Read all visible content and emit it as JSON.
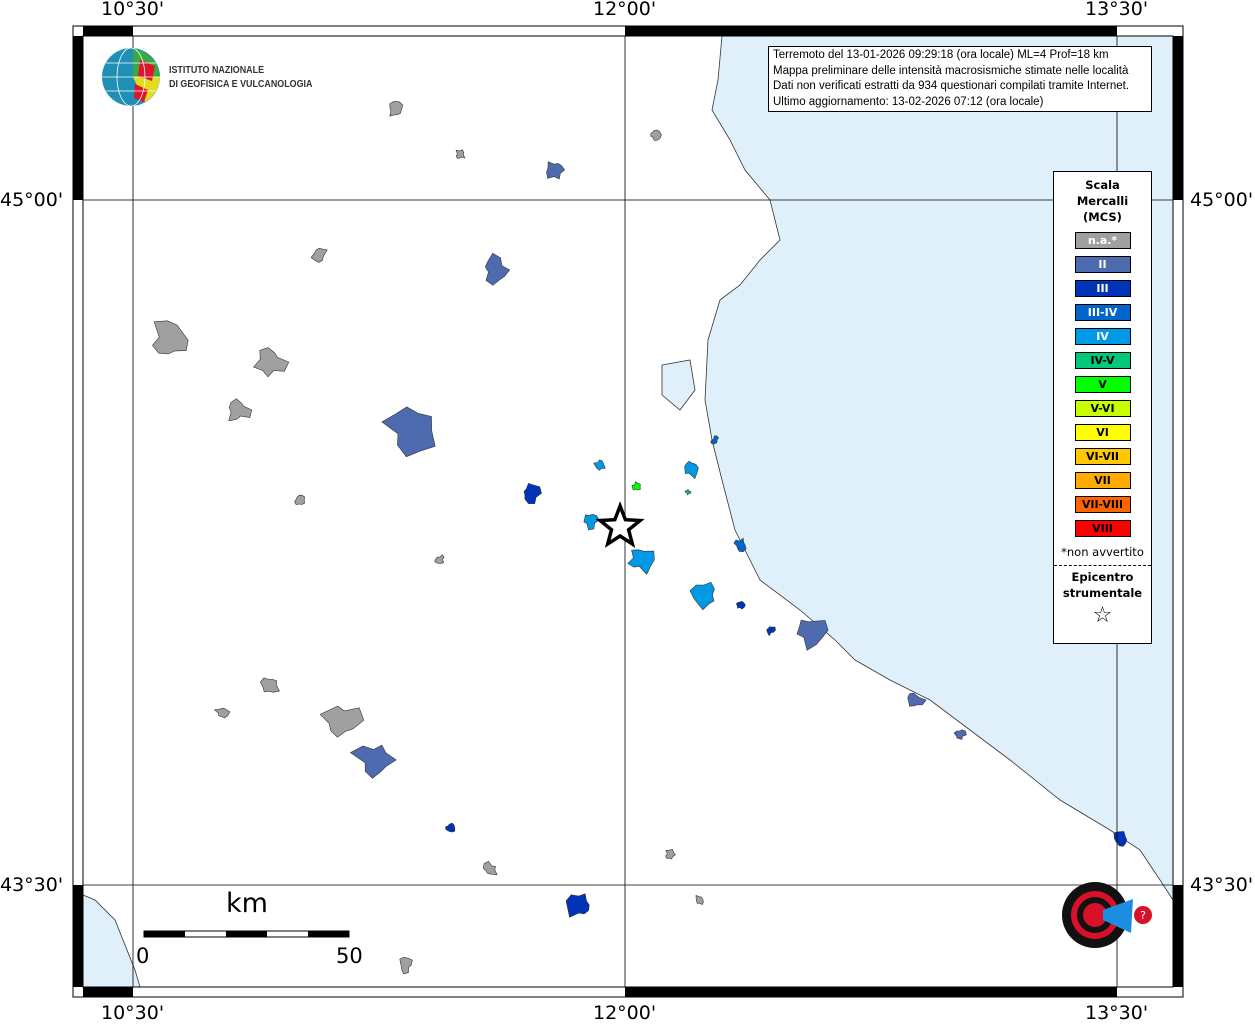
{
  "header_info": {
    "line1": "Terremoto del 13-01-2026 09:29:18 (ora locale) ML=4 Prof=18 km",
    "line2": "Mappa preliminare delle intensità macrosismiche stimate nelle località",
    "line3": "Dati non verificati estratti da 934 questionari compilati tramite Internet.",
    "line4": "Ultimo aggiornamento: 13-02-2026 07:12 (ora locale)"
  },
  "logo_ingv": {
    "line1": "ISTITUTO NAZIONALE",
    "line2": "DI GEOFISICA E VULCANOLOGIA"
  },
  "logo_hsit": "www.haisentitoilterremoto.it",
  "axes": {
    "lon_ticks": [
      "10°30'",
      "12°00'",
      "13°30'"
    ],
    "lat_ticks": [
      "45°00'",
      "43°30'"
    ],
    "lon_values": [
      10.5,
      12.0,
      13.5
    ],
    "lat_values": [
      45.0,
      43.5
    ]
  },
  "legend": {
    "title": [
      "Scala",
      "Mercalli",
      "(MCS)"
    ],
    "classes": [
      {
        "label": "n.a.*",
        "color": "#a0a0a0",
        "text": "#ffffff"
      },
      {
        "label": "II",
        "color": "#4f6bb0",
        "text": "#ffffff"
      },
      {
        "label": "III",
        "color": "#0033b8",
        "text": "#ffffff"
      },
      {
        "label": "III-IV",
        "color": "#0066cc",
        "text": "#ffffff"
      },
      {
        "label": "IV",
        "color": "#0099e6",
        "text": "#ffffff"
      },
      {
        "label": "IV-V",
        "color": "#00c878",
        "text": "#000000"
      },
      {
        "label": "V",
        "color": "#00ff00",
        "text": "#000000"
      },
      {
        "label": "V-VI",
        "color": "#c8ff00",
        "text": "#000000"
      },
      {
        "label": "VI",
        "color": "#ffff00",
        "text": "#000000"
      },
      {
        "label": "VI-VII",
        "color": "#ffc800",
        "text": "#000000"
      },
      {
        "label": "VII",
        "color": "#ffaa00",
        "text": "#000000"
      },
      {
        "label": "VII-VIII",
        "color": "#ff6400",
        "text": "#000000"
      },
      {
        "label": "VIII",
        "color": "#ff0000",
        "text": "#000000"
      }
    ],
    "note": "*non avvertito",
    "epicenter_title": [
      "Epicentro",
      "strumentale"
    ]
  },
  "scale_bar": {
    "unit": "km",
    "start": "0",
    "end": "50"
  },
  "epicenter": {
    "lon": 11.985,
    "lat": 44.284
  },
  "colors": {
    "sea": "#e0f0fb",
    "land": "#ffffff"
  },
  "localities": [
    {
      "lon": 10.613,
      "lat": 44.693,
      "i": "n.a.*"
    },
    {
      "lon": 10.918,
      "lat": 44.645,
      "i": "n.a.*"
    },
    {
      "lon": 10.82,
      "lat": 44.54,
      "i": "n.a.*"
    },
    {
      "lon": 11.131,
      "lat": 43.861,
      "i": "n.a.*"
    },
    {
      "lon": 10.918,
      "lat": 43.938,
      "i": "n.a.*"
    },
    {
      "lon": 11.07,
      "lat": 44.88,
      "i": "n.a.*"
    },
    {
      "lon": 11.299,
      "lat": 45.197,
      "i": "n.a.*"
    },
    {
      "lon": 12.091,
      "lat": 45.142,
      "i": "n.a.*"
    },
    {
      "lon": 11.497,
      "lat": 45.099,
      "i": "n.a.*"
    },
    {
      "lon": 11.329,
      "lat": 43.325,
      "i": "n.a.*"
    },
    {
      "lon": 11.588,
      "lat": 43.533,
      "i": "n.a.*"
    },
    {
      "lon": 12.229,
      "lat": 43.467,
      "i": "n.a.*"
    },
    {
      "lon": 12.137,
      "lat": 43.566,
      "i": "n.a.*"
    },
    {
      "lon": 10.771,
      "lat": 43.879,
      "i": "n.a.*"
    },
    {
      "lon": 11.436,
      "lat": 44.212,
      "i": "n.a.*"
    },
    {
      "lon": 11.009,
      "lat": 44.343,
      "i": "n.a.*"
    },
    {
      "lon": 11.345,
      "lat": 44.496,
      "i": "II"
    },
    {
      "lon": 11.604,
      "lat": 44.847,
      "i": "II"
    },
    {
      "lon": 11.238,
      "lat": 43.774,
      "i": "II"
    },
    {
      "lon": 11.787,
      "lat": 45.066,
      "i": "II"
    },
    {
      "lon": 12.884,
      "lat": 43.905,
      "i": "II"
    },
    {
      "lon": 12.564,
      "lat": 44.058,
      "i": "II"
    },
    {
      "lon": 13.021,
      "lat": 43.829,
      "i": "II"
    },
    {
      "lon": 11.71,
      "lat": 44.358,
      "i": "III"
    },
    {
      "lon": 11.863,
      "lat": 43.456,
      "i": "III"
    },
    {
      "lon": 11.466,
      "lat": 43.625,
      "i": "III"
    },
    {
      "lon": 13.509,
      "lat": 43.599,
      "i": "III"
    },
    {
      "lon": 12.442,
      "lat": 44.058,
      "i": "III"
    },
    {
      "lon": 12.351,
      "lat": 44.113,
      "i": "III"
    },
    {
      "lon": 12.351,
      "lat": 44.245,
      "i": "III-IV"
    },
    {
      "lon": 12.274,
      "lat": 44.474,
      "i": "III-IV"
    },
    {
      "lon": 12.046,
      "lat": 44.212,
      "i": "IV"
    },
    {
      "lon": 11.893,
      "lat": 44.299,
      "i": "IV"
    },
    {
      "lon": 12.198,
      "lat": 44.413,
      "i": "IV"
    },
    {
      "lon": 12.244,
      "lat": 44.135,
      "i": "IV"
    },
    {
      "lon": 11.924,
      "lat": 44.42,
      "i": "IV"
    },
    {
      "lon": 12.192,
      "lat": 44.361,
      "i": "IV-V"
    },
    {
      "lon": 12.034,
      "lat": 44.372,
      "i": "V"
    }
  ]
}
